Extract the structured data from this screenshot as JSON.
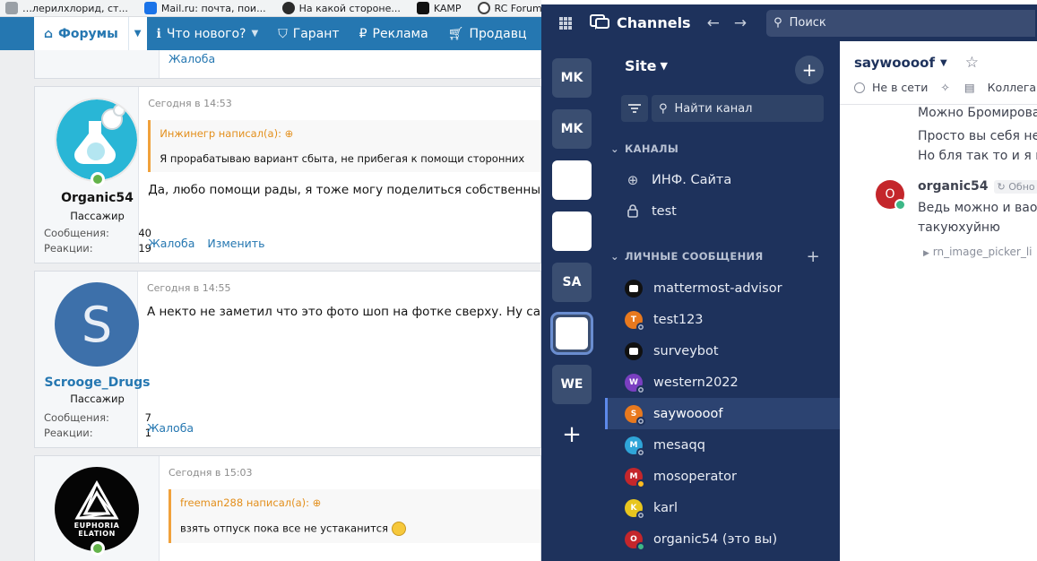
{
  "browser": {
    "bookmarks": [
      {
        "label": "…лерилхлорид, ст...",
        "color": "#9aa0a6"
      },
      {
        "label": "Mail.ru: почта, пои...",
        "color": "#1a73e8"
      },
      {
        "label": "На какой стороне...",
        "color": "#2b2b2b"
      },
      {
        "label": "KAMP",
        "color": "#111111"
      },
      {
        "label": "RC Forum Legaliz",
        "color": "#444444"
      }
    ]
  },
  "forum": {
    "nav": {
      "forums": "Форумы",
      "whats_new": "Что нового?",
      "guarantee": "Гарант",
      "ads": "Реклама",
      "sellers": "Продавц"
    },
    "top_action": "Жалоба",
    "posts": [
      {
        "date": "Сегодня в 14:53",
        "quote_author": "Инжинегр написал(а):",
        "quote_text": "Я прорабатываю вариант сбыта, не прибегая к помощи сторонних",
        "text": "Да, любо помощи рады, я тоже могу поделиться собственны",
        "username": "Organic54",
        "role": "Пассажир",
        "messages_label": "Сообщения:",
        "messages": "40",
        "reactions_label": "Реакции:",
        "reactions": "19",
        "actions": [
          "Жалоба",
          "Изменить"
        ]
      },
      {
        "date": "Сегодня в 14:55",
        "text": "А некто не заметил что это фото шоп на фотке сверху. Ну са",
        "username": "Scrooge_Drugs",
        "avatar_letter": "S",
        "role": "Пассажир",
        "messages_label": "Сообщения:",
        "messages": "7",
        "reactions_label": "Реакции:",
        "reactions": "1",
        "actions": [
          "Жалоба"
        ]
      },
      {
        "date": "Сегодня в 15:03",
        "quote_author": "freeman288 написал(а):",
        "quote_text": "взять отпуск пока все не устаканится",
        "avatar_text_1": "EUPHORIA",
        "avatar_text_2": "ELATION"
      }
    ]
  },
  "mattermost": {
    "app_title": "Channels",
    "search_placeholder": "Поиск",
    "teams": [
      "MK",
      "MK",
      "",
      "",
      "SA",
      "",
      "WE"
    ],
    "team_name": "Site",
    "find_channel": "Найти канал",
    "channels_header": "КАНАЛЫ",
    "channels": [
      {
        "name": "ИНФ. Сайта",
        "icon": "globe-icon"
      },
      {
        "name": "test",
        "icon": "lock-icon"
      }
    ],
    "dm_header": "ЛИЧНЫЕ СООБЩЕНИЯ",
    "dms": [
      {
        "name": "mattermost-advisor",
        "initial": "",
        "color": "#111111",
        "status": "bot"
      },
      {
        "name": "test123",
        "initial": "T",
        "color": "#e8791e",
        "status": "off"
      },
      {
        "name": "surveybot",
        "initial": "",
        "color": "#111111",
        "status": "bot"
      },
      {
        "name": "western2022",
        "initial": "W",
        "color": "#7a3fc1",
        "status": "off"
      },
      {
        "name": "saywoooof",
        "initial": "S",
        "color": "#e8791e",
        "status": "off",
        "active": true
      },
      {
        "name": "mesaqq",
        "initial": "M",
        "color": "#2fa5d8",
        "status": "off"
      },
      {
        "name": "mosoperator",
        "initial": "M",
        "color": "#c4262b",
        "status": "away"
      },
      {
        "name": "karl",
        "initial": "K",
        "color": "#e8c61e",
        "status": "off"
      },
      {
        "name": "organic54 (это вы)",
        "initial": "O",
        "color": "#c4262b",
        "status": "on"
      }
    ],
    "main": {
      "channel_title": "saywoooof",
      "status": "Не в сети",
      "colleague": "Коллега",
      "lines": [
        "Можно Бромирова",
        "Просто вы себя не",
        "Но бля так то и я н"
      ],
      "author": "organic54",
      "edited": "Обно",
      "avatar_initial": "O",
      "msg_lines": [
        "Ведь можно и вао",
        "такуюхуйню"
      ],
      "attachment": "rn_image_picker_li"
    }
  }
}
